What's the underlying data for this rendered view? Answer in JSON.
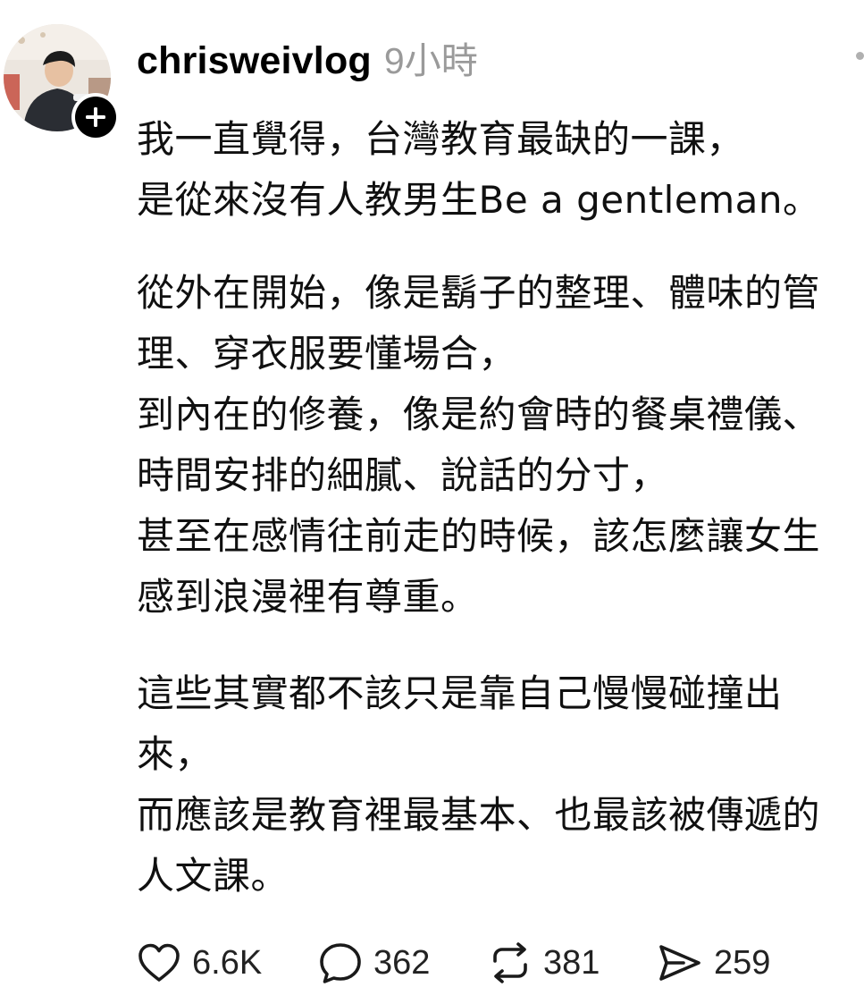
{
  "post": {
    "author": {
      "username": "chrisweivlog",
      "avatar_icon": "user-photo-avatar",
      "follow_icon": "plus-icon"
    },
    "time": "9小時",
    "lines": [
      "我一直覺得，台灣教育最缺的一課，",
      "是從來沒有人教男生Be a gentleman。",
      "從外在開始，像是鬍子的整理、體味的管",
      "理、穿衣服要懂場合，",
      "到內在的修養，像是約會時的餐桌禮儀、",
      "時間安排的細膩、說話的分寸，",
      "甚至在感情往前走的時候，該怎麼讓女生",
      "感到浪漫裡有尊重。",
      "這些其實都不該只是靠自己慢慢碰撞出",
      "來，",
      "而應該是教育裡最基本、也最該被傳遞的",
      "人文課。"
    ],
    "stats": {
      "likes": "6.6K",
      "replies": "362",
      "reposts": "381",
      "shares": "259"
    },
    "colors": {
      "text": "#101010",
      "muted": "#9a9a9a",
      "badge": "#000000"
    }
  }
}
